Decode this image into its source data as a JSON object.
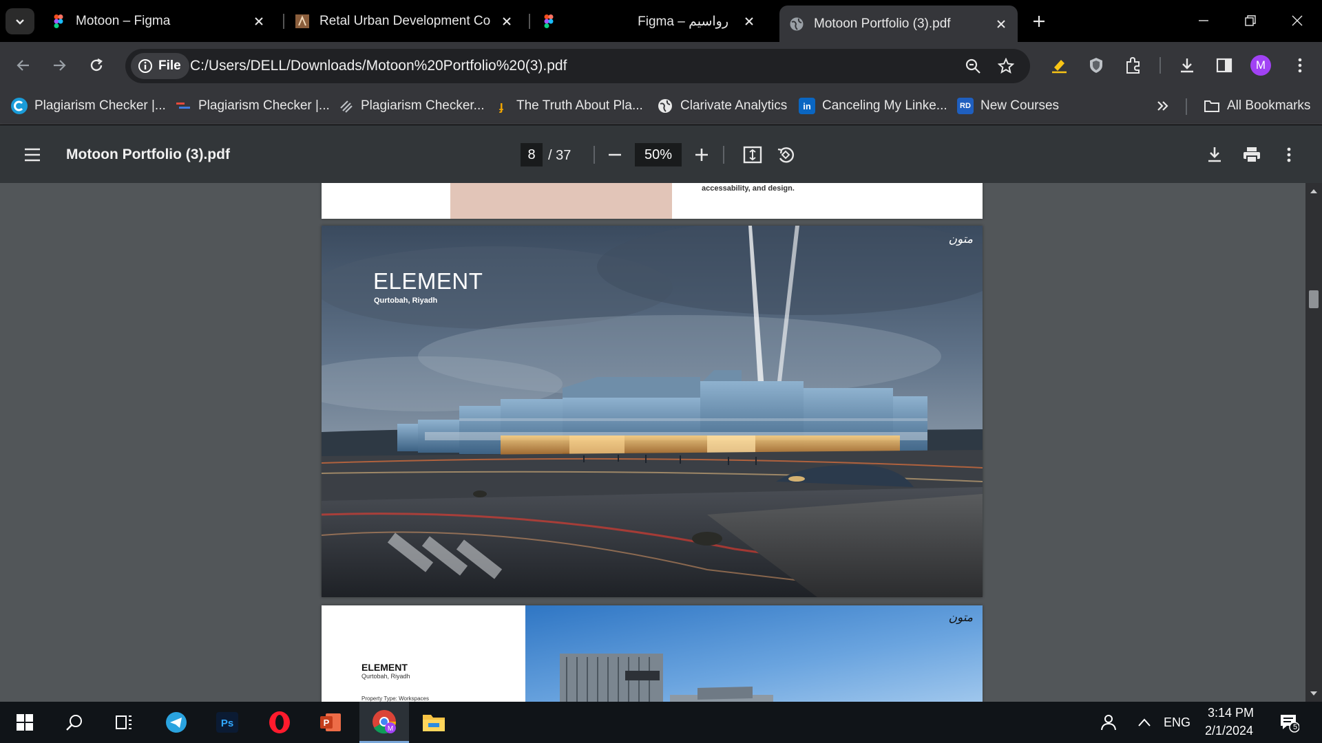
{
  "tabs": [
    {
      "title": "Motoon – Figma"
    },
    {
      "title": "Retal Urban Development Comp"
    },
    {
      "title": "Figma – رواسيم"
    },
    {
      "title": "Motoon Portfolio (3).pdf"
    }
  ],
  "address": {
    "chip_label": "File",
    "url": "C:/Users/DELL/Downloads/Motoon%20Portfolio%20(3).pdf"
  },
  "avatar": {
    "initial": "M",
    "color": "#a142f4"
  },
  "bookmarks": [
    {
      "label": "Plagiarism Checker |...",
      "icon": "quillbot-icon"
    },
    {
      "label": "Plagiarism Checker |...",
      "icon": "smallseo-icon"
    },
    {
      "label": "Plagiarism Checker...",
      "icon": "grammarly-icon"
    },
    {
      "label": "The Truth About Pla...",
      "icon": "bookmark-icon"
    },
    {
      "label": "Clarivate Analytics",
      "icon": "globe-icon"
    },
    {
      "label": "Canceling My Linke...",
      "icon": "linkedin-icon",
      "badge": "in"
    },
    {
      "label": "New Courses",
      "icon": "rd-icon",
      "badge": "RD"
    }
  ],
  "all_bookmarks_label": "All Bookmarks",
  "pdf": {
    "title": "Motoon Portfolio (3).pdf",
    "current_page": "8",
    "total_pages": "/ 37",
    "zoom": "50%"
  },
  "pages": {
    "prev": {
      "snippet": "accessability, and design."
    },
    "main": {
      "title": "ELEMENT",
      "subtitle": "Qurtobah, Riyadh",
      "logo": "متون"
    },
    "next": {
      "title": "ELEMENT",
      "subtitle": "Qurtobah, Riyadh",
      "property": "Property Type:  Workspaces",
      "logo": "متون"
    }
  },
  "taskbar": {
    "lang": "ENG",
    "time": "3:14 PM",
    "date": "2/1/2024",
    "notifications": "5"
  }
}
